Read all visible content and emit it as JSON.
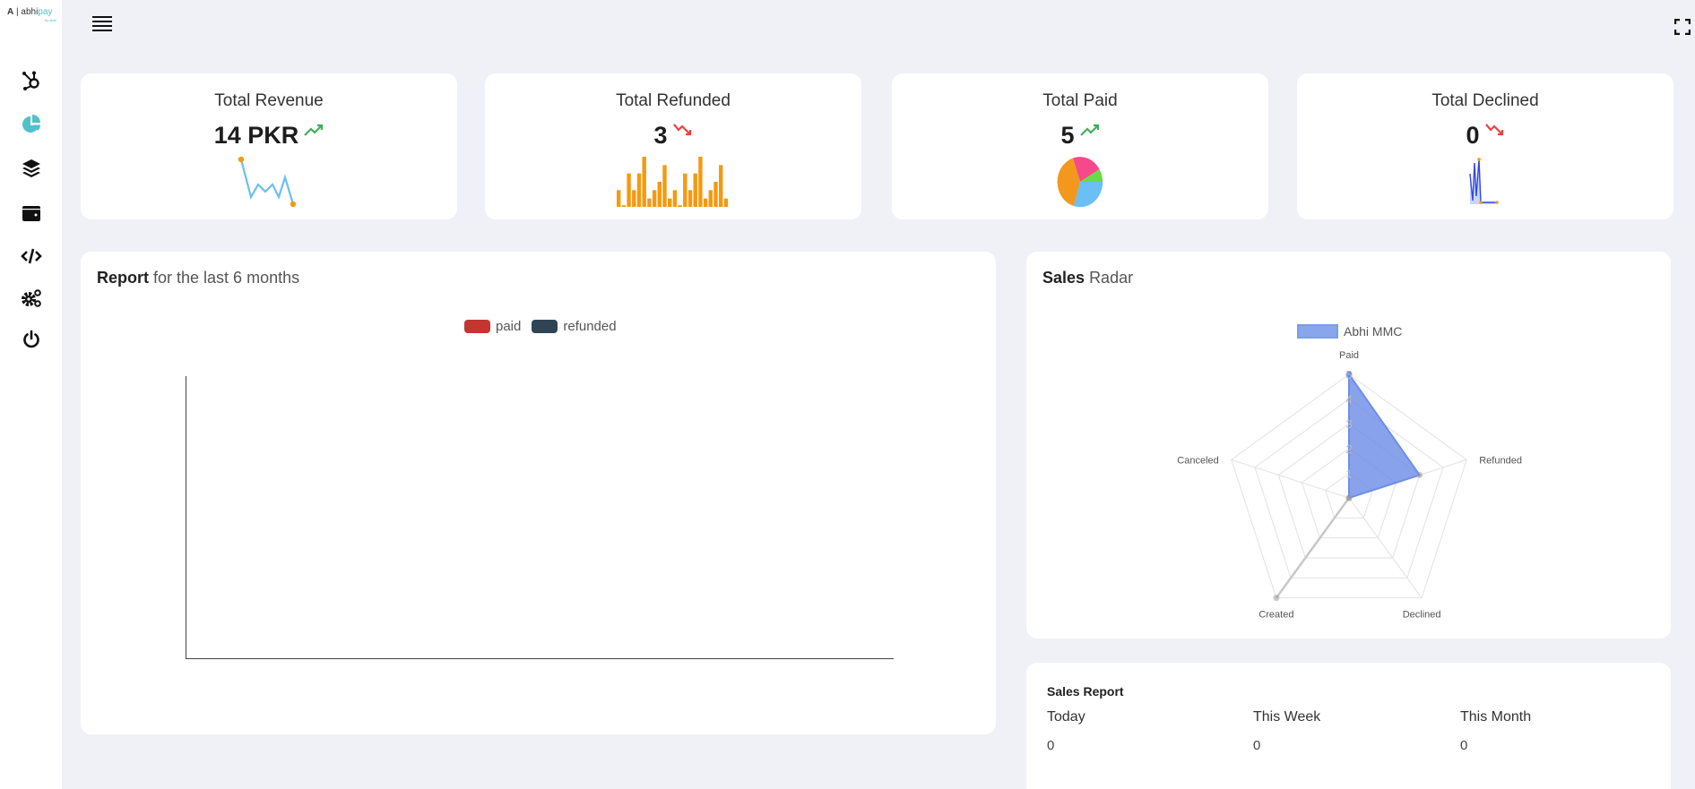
{
  "brand": {
    "logo_mark": "A",
    "logo_text_a": "abhi",
    "logo_text_b": "pay",
    "logo_sub": "by abhi"
  },
  "sidebar": {
    "items": [
      {
        "icon": "hub-icon"
      },
      {
        "icon": "pie-chart-icon",
        "active": true
      },
      {
        "icon": "layers-icon"
      },
      {
        "icon": "wallet-icon"
      },
      {
        "icon": "code-icon"
      },
      {
        "icon": "cogs-icon"
      },
      {
        "icon": "power-icon"
      }
    ],
    "active_color": "#4fc1c9"
  },
  "kpis": [
    {
      "title": "Total Revenue",
      "value": "14 PKR",
      "trend": "up"
    },
    {
      "title": "Total Refunded",
      "value": "3",
      "trend": "down"
    },
    {
      "title": "Total Paid",
      "value": "5",
      "trend": "up"
    },
    {
      "title": "Total Declined",
      "value": "0",
      "trend": "down"
    }
  ],
  "colors": {
    "up": "#3fae5a",
    "down": "#f0403c",
    "spark_line": "#6abff5",
    "spark_bar": "#f6990f",
    "paid": "#c23531",
    "refunded": "#2f4554",
    "radar_fill": "#7b9cea"
  },
  "report": {
    "title_bold": "Report",
    "title_rest": "for the last 6 months"
  },
  "radar_card": {
    "title_bold": "Sales",
    "title_rest": "Radar"
  },
  "sales_report": {
    "title": "Sales Report",
    "columns": [
      {
        "label": "Today",
        "value": "0"
      },
      {
        "label": "This Week",
        "value": "0"
      },
      {
        "label": "This Month",
        "value": "0"
      }
    ]
  },
  "chart_data": [
    {
      "type": "line",
      "legend": [
        "paid",
        "refunded"
      ],
      "series": [
        {
          "name": "paid",
          "values": []
        },
        {
          "name": "refunded",
          "values": []
        }
      ],
      "legend_placement": "top"
    },
    {
      "type": "radar",
      "categories": [
        "Paid",
        "Refunded",
        "Declined",
        "Created",
        "Canceled"
      ],
      "series": [
        {
          "name": "Abhi MMC",
          "values": [
            5,
            3,
            0,
            5,
            0
          ]
        }
      ],
      "ticks": [
        "1",
        "2",
        "3",
        "4",
        "5"
      ],
      "rmax": 5,
      "legend_placement": "top"
    }
  ]
}
